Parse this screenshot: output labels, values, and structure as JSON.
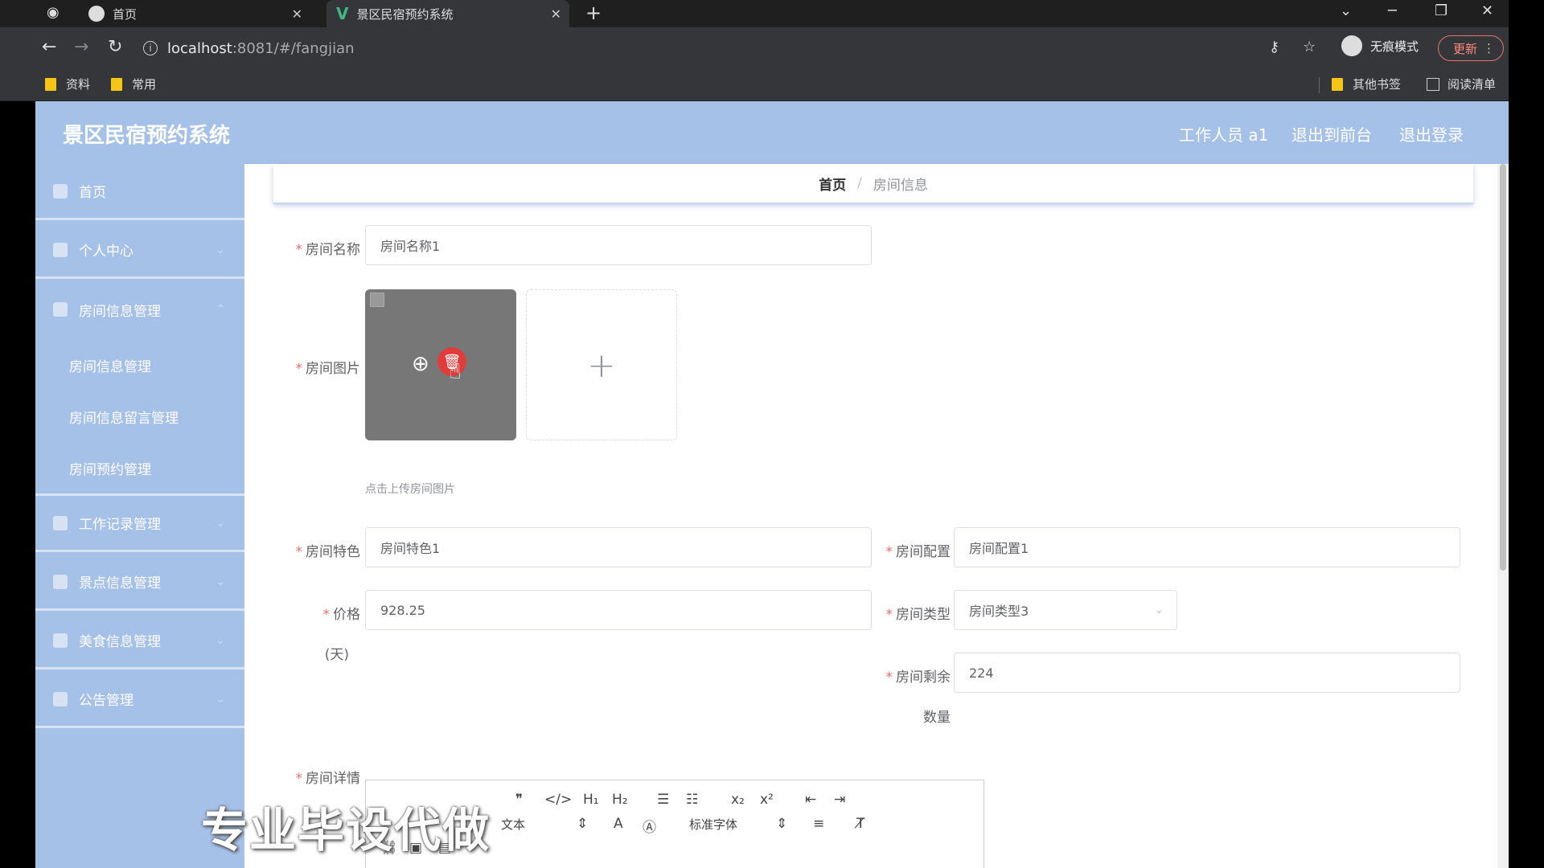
{
  "browser": {
    "tabs": [
      {
        "title": "首页"
      },
      {
        "title": "景区民宿预约系统"
      }
    ],
    "url_host": "localhost",
    "url_rest": ":8081/#/fangjian",
    "incognito_label": "无痕模式",
    "update_label": "更新",
    "bookmarks": [
      "资料",
      "常用"
    ],
    "other_bookmarks": "其他书签",
    "reading_list": "阅读清单"
  },
  "header": {
    "title": "景区民宿预约系统",
    "user": "工作人员 a1",
    "to_front": "退出到前台",
    "logout": "退出登录"
  },
  "sidebar": {
    "items": [
      {
        "label": "首页",
        "icon": "home-icon"
      },
      {
        "label": "个人中心",
        "icon": "user-icon"
      },
      {
        "label": "房间信息管理",
        "icon": "room-icon"
      },
      {
        "label": "工作记录管理",
        "icon": "record-icon"
      },
      {
        "label": "景点信息管理",
        "icon": "grid-icon"
      },
      {
        "label": "美食信息管理",
        "icon": "food-icon"
      },
      {
        "label": "公告管理",
        "icon": "notice-icon"
      }
    ],
    "sub_items": [
      "房间信息管理",
      "房间信息留言管理",
      "房间预约管理"
    ]
  },
  "breadcrumb": {
    "home": "首页",
    "current": "房间信息"
  },
  "form": {
    "name_label": "房间名称",
    "name_value": "房间名称1",
    "image_label": "房间图片",
    "upload_tip": "点击上传房间图片",
    "feature_label": "房间特色",
    "feature_value": "房间特色1",
    "config_label": "房间配置",
    "config_value": "房间配置1",
    "price_label": "价格",
    "price_label_unit": "(天)",
    "price_value": "928.25",
    "type_label": "房间类型",
    "type_value": "房间类型3",
    "remain_label": "房间剩余",
    "remain_label2": "数量",
    "remain_value": "224",
    "detail_label": "房间详情"
  },
  "editor": {
    "font_size_label": "文本",
    "font_family_label": "标准字体"
  },
  "watermark": "专业毕设代做"
}
